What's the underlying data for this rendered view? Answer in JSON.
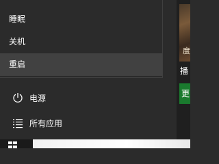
{
  "power_menu": {
    "items": [
      {
        "label": "睡眠"
      },
      {
        "label": "关机"
      },
      {
        "label": "重启"
      }
    ]
  },
  "start": {
    "power_label": "电源",
    "all_apps_label": "所有应用"
  },
  "tiles": {
    "photo_char": "度",
    "label_char": "播",
    "green_char": "更"
  },
  "colors": {
    "menu_bg": "#2b2b2b",
    "highlight_bg": "#414141",
    "green_tile": "#1a7a2e"
  },
  "icons": {
    "power": "power-icon",
    "all_apps": "all-apps-icon",
    "start": "windows-logo-icon"
  }
}
